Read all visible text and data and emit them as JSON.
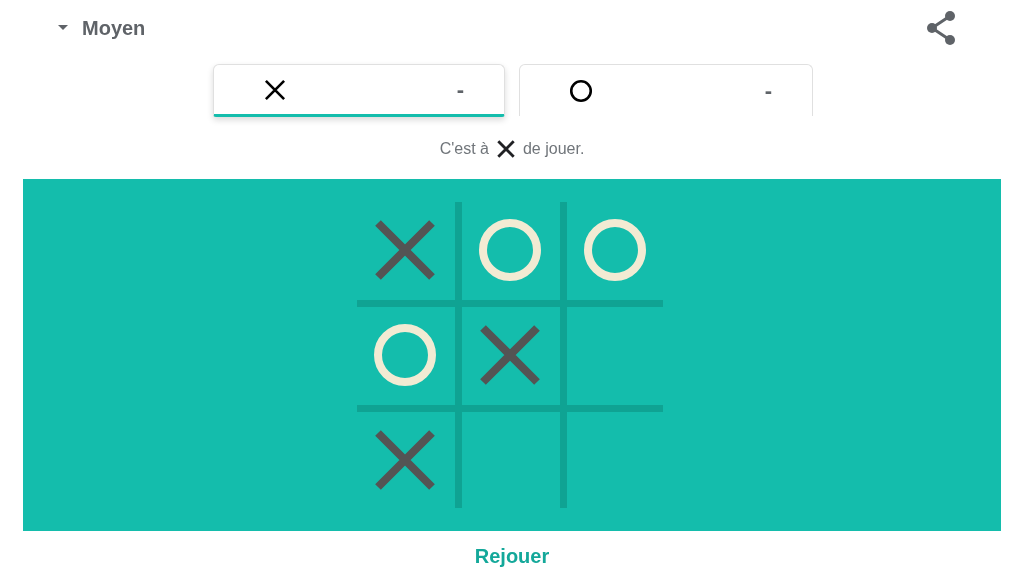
{
  "difficulty": {
    "label": "Moyen",
    "expanded": false
  },
  "players": [
    {
      "kind": "x",
      "score": "-",
      "selected": true
    },
    {
      "kind": "o",
      "score": "-",
      "selected": false
    }
  ],
  "status": {
    "before": "C'est à",
    "turn": {
      "kind": "x"
    },
    "after": "de jouer."
  },
  "board": [
    {
      "kind": "x"
    },
    {
      "kind": "o"
    },
    {
      "kind": "o"
    },
    {
      "kind": "o"
    },
    {
      "kind": "x"
    },
    {
      "kind": "empty"
    },
    {
      "kind": "x"
    },
    {
      "kind": "empty"
    },
    {
      "kind": "empty"
    }
  ],
  "replay_button": "Rejouer"
}
